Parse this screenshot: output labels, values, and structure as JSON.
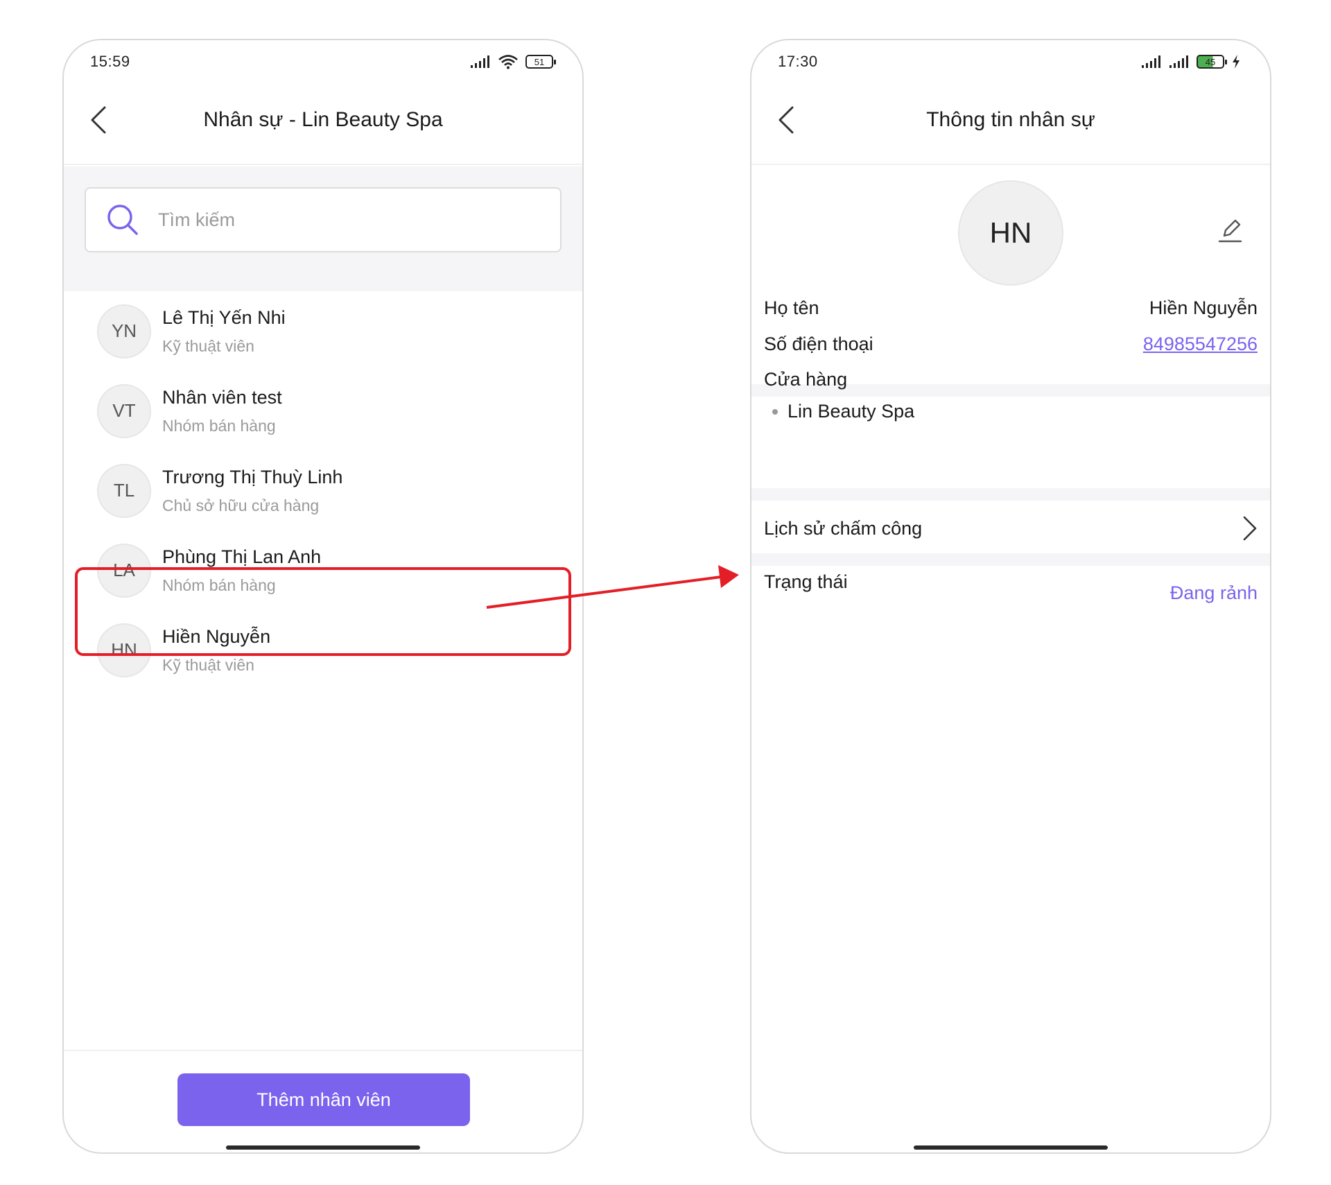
{
  "left_screen": {
    "status_time": "15:59",
    "battery": "51",
    "title": "Nhân sự - Lin Beauty Spa",
    "search_placeholder": "Tìm kiếm",
    "staff": [
      {
        "initials": "YN",
        "name": "Lê Thị Yến Nhi",
        "role": "Kỹ thuật viên"
      },
      {
        "initials": "VT",
        "name": "Nhân viên test",
        "role": "Nhóm bán hàng"
      },
      {
        "initials": "TL",
        "name": "Trương Thị Thuỳ Linh",
        "role": "Chủ sở hữu cửa hàng"
      },
      {
        "initials": "LA",
        "name": "Phùng Thị Lan Anh",
        "role": "Nhóm bán hàng"
      },
      {
        "initials": "HN",
        "name": "Hiền Nguyễn",
        "role": "Kỹ thuật viên"
      }
    ],
    "add_button": "Thêm nhân viên"
  },
  "right_screen": {
    "status_time": "17:30",
    "battery": "45",
    "title": "Thông tin nhân sự",
    "avatar_initials": "HN",
    "name_label": "Họ tên",
    "name_value": "Hiền Nguyễn",
    "phone_label": "Số điện thoại",
    "phone_value": "84985547256",
    "store_label": "Cửa hàng",
    "store_value": "Lin Beauty Spa",
    "attendance_label": "Lịch sử chấm công",
    "status_label": "Trạng thái",
    "status_value": "Đang rảnh"
  },
  "colors": {
    "accent": "#7b63ee",
    "highlight": "#e41e26",
    "divider_bg": "#f5f5f7"
  }
}
